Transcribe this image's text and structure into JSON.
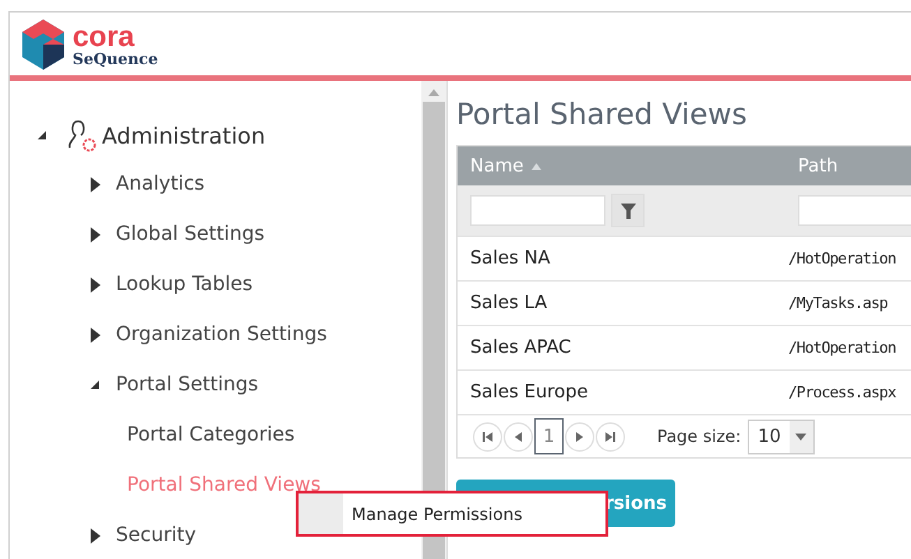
{
  "header": {
    "logo_word": "cora",
    "logo_subword": "SeQuence"
  },
  "sidebar": {
    "tree": [
      {
        "label": "Administration",
        "expanded": true,
        "selected": false,
        "children": [
          {
            "label": "Analytics",
            "expanded": false,
            "selected": false
          },
          {
            "label": "Global Settings",
            "expanded": false,
            "selected": false
          },
          {
            "label": "Lookup Tables",
            "expanded": false,
            "selected": false
          },
          {
            "label": "Organization Settings",
            "expanded": false,
            "selected": false
          },
          {
            "label": "Portal Settings",
            "expanded": true,
            "selected": false,
            "children": [
              {
                "label": "Portal Categories",
                "selected": false
              },
              {
                "label": "Portal Shared Views",
                "selected": true
              }
            ]
          },
          {
            "label": "Security",
            "expanded": false,
            "selected": false
          }
        ]
      }
    ]
  },
  "main": {
    "title": "Portal Shared Views",
    "table": {
      "columns": [
        {
          "label": "Name",
          "sorted": true
        },
        {
          "label": "Path",
          "sorted": false
        }
      ],
      "rows": [
        [
          "Sales NA",
          "/HotOperation"
        ],
        [
          "Sales LA",
          "/MyTasks.asp"
        ],
        [
          "Sales APAC",
          "/HotOperation"
        ],
        [
          "Sales Europe",
          "/Process.aspx"
        ]
      ],
      "pager": {
        "pages": [
          {
            "label": "1",
            "selected": true
          }
        ],
        "page_size_label": "Page size:",
        "page_size": "10"
      }
    },
    "button": "rsions"
  },
  "context_menu": {
    "items": [
      "Manage Permissions"
    ]
  }
}
